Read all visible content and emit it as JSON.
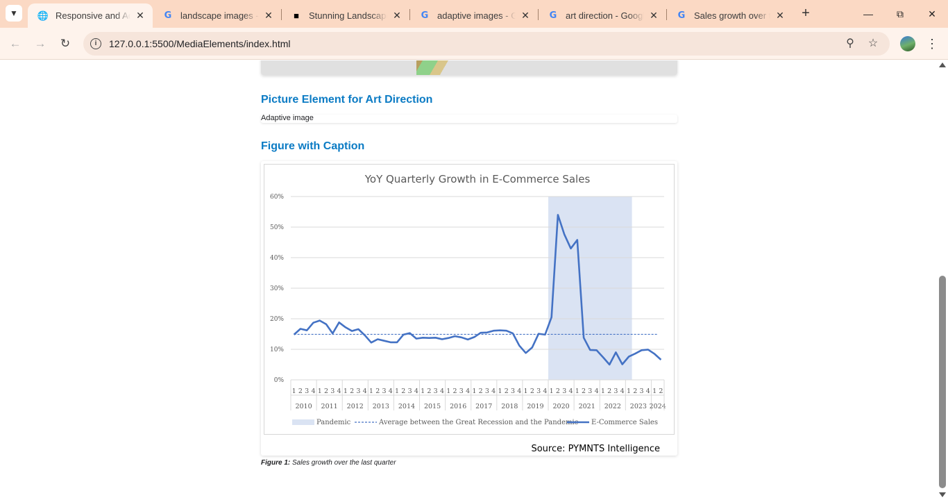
{
  "browser": {
    "tabs": [
      {
        "title": "Responsive and Adap",
        "icon": "globe-icon",
        "active": true
      },
      {
        "title": "landscape images - G",
        "icon": "google-icon",
        "active": false
      },
      {
        "title": "Stunning Landscape P",
        "icon": "unsplash-icon",
        "active": false
      },
      {
        "title": "adaptive images - Go",
        "icon": "google-icon",
        "active": false
      },
      {
        "title": "art direction - Google",
        "icon": "google-icon",
        "active": false
      },
      {
        "title": "Sales growth over the",
        "icon": "google-icon",
        "active": false
      }
    ],
    "url": "127.0.0.1:5500/MediaElements/index.html"
  },
  "page": {
    "art_direction_heading": "Picture Element for Art Direction",
    "broken_image_alt": "Adaptive image",
    "figure_heading": "Figure with Caption",
    "figure_source": "Source: PYMNTS Intelligence",
    "caption_label": "Figure 1:",
    "caption_text": " Sales growth over the last quarter"
  },
  "chart_data": {
    "type": "line",
    "title": "YoY Quarterly Growth in E-Commerce Sales",
    "ylim": [
      0,
      60
    ],
    "yticks": [
      "0%",
      "10%",
      "20%",
      "30%",
      "40%",
      "50%",
      "60%"
    ],
    "years": [
      "2010",
      "2011",
      "2012",
      "2013",
      "2014",
      "2015",
      "2016",
      "2017",
      "2018",
      "2019",
      "2020",
      "2021",
      "2022",
      "2023",
      "2024"
    ],
    "quarter_labels": [
      "1",
      "2",
      "3",
      "4"
    ],
    "quarters_last_year": 2,
    "grid": true,
    "legend_position": "bottom",
    "series": [
      {
        "name": "E-Commerce Sales",
        "color": "#4472c4",
        "values": [
          14.8,
          16.7,
          16.2,
          18.7,
          19.4,
          18.2,
          15.2,
          18.8,
          17.2,
          16.0,
          16.6,
          14.6,
          12.2,
          13.3,
          12.8,
          12.3,
          12.3,
          14.8,
          15.3,
          13.5,
          13.8,
          13.7,
          13.8,
          13.3,
          13.7,
          14.3,
          13.9,
          13.2,
          14.0,
          15.4,
          15.5,
          16.1,
          16.2,
          16.1,
          15.2,
          11.2,
          8.8,
          10.6,
          15.1,
          14.8,
          20.5,
          54.0,
          47.6,
          43.0,
          45.8,
          13.8,
          9.8,
          9.7,
          7.4,
          5.0,
          9.0,
          5.1,
          7.6,
          8.6,
          9.7,
          9.9,
          8.5,
          6.6
        ]
      },
      {
        "name": "Average between the Great Recession and the Pandemic",
        "color": "#4472c4",
        "dashed": true,
        "values": [
          14.9
        ]
      }
    ],
    "shaded_region": {
      "name": "Pandemic",
      "color": "#dae3f3",
      "from_index": 40,
      "to_index": 52
    }
  }
}
